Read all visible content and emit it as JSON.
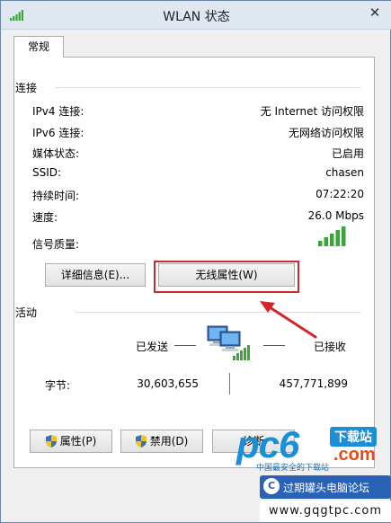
{
  "window": {
    "title": "WLAN 状态",
    "close_label": "✕"
  },
  "tab": {
    "label": "常规"
  },
  "connection": {
    "group_label": "连接",
    "rows": [
      {
        "label": "IPv4 连接:",
        "value": "无 Internet 访问权限"
      },
      {
        "label": "IPv6 连接:",
        "value": "无网络访问权限"
      },
      {
        "label": "媒体状态:",
        "value": "已启用"
      },
      {
        "label": "SSID:",
        "value": "chasen"
      },
      {
        "label": "持续时间:",
        "value": "07:22:20"
      },
      {
        "label": "速度:",
        "value": "26.0 Mbps"
      }
    ],
    "signal_label": "信号质量:",
    "signal_bars_filled": 5,
    "details_button": "详细信息(E)...",
    "wireless_button": "无线属性(W)"
  },
  "activity": {
    "group_label": "活动",
    "sent_label": "已发送",
    "received_label": "已接收",
    "bytes_label": "字节:",
    "bytes_sent": "30,603,655",
    "bytes_received": "457,771,899"
  },
  "buttons": {
    "properties": "属性(P)",
    "disable": "禁用(D)",
    "diagnose": "诊断"
  },
  "watermark": {
    "pc": "pc6",
    "download": "下载站",
    "com": ".com",
    "slogan": "中国最安全的下载站",
    "forum": "过期罐头电脑论坛",
    "url": "www.gqgtpc.com"
  },
  "colors": {
    "accent_red": "#d3262b",
    "signal_green": "#3aa63a",
    "titlebar": "#dfe7f1"
  }
}
